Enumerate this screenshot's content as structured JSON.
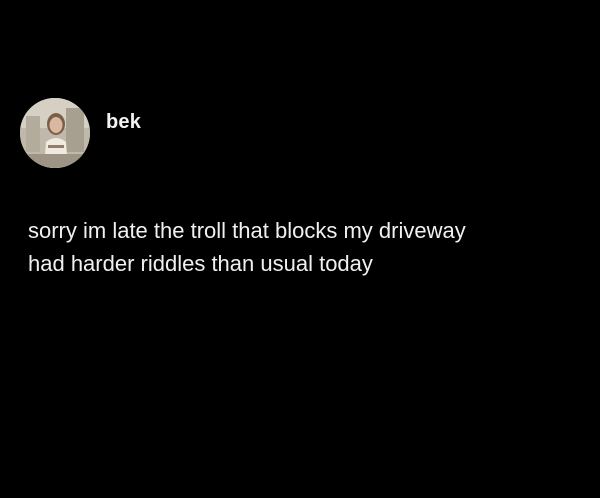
{
  "post": {
    "author": {
      "username": "bek",
      "avatar_icon": "profile-photo"
    },
    "text": "sorry im late the troll that blocks my driveway\nhad harder riddles than usual today"
  },
  "colors": {
    "background": "#000000",
    "text": "#f0f0f0"
  }
}
